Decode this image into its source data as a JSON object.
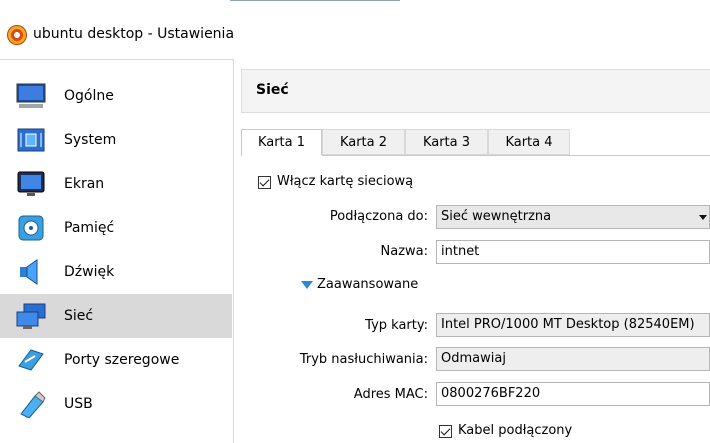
{
  "window": {
    "title": "ubuntu desktop - Ustawienia"
  },
  "sidebar": {
    "items": [
      {
        "label": "Ogólne",
        "icon": "monitor-general-icon"
      },
      {
        "label": "System",
        "icon": "chip-icon"
      },
      {
        "label": "Ekran",
        "icon": "display-icon"
      },
      {
        "label": "Pamięć",
        "icon": "disk-icon"
      },
      {
        "label": "Dźwięk",
        "icon": "speaker-icon"
      },
      {
        "label": "Sieć",
        "icon": "network-icon",
        "selected": true
      },
      {
        "label": "Porty szeregowe",
        "icon": "serial-port-icon"
      },
      {
        "label": "USB",
        "icon": "usb-icon"
      }
    ]
  },
  "panel": {
    "title": "Sieć",
    "tabs": [
      {
        "label": "Karta 1",
        "active": true
      },
      {
        "label": "Karta 2"
      },
      {
        "label": "Karta 3"
      },
      {
        "label": "Karta 4"
      }
    ],
    "enable_adapter_label": "Włącz kartę sieciową",
    "attached_to_label": "Podłączona do:",
    "attached_to_value": "Sieć wewnętrzna",
    "name_label": "Nazwa:",
    "name_value": "intnet",
    "advanced_label": "Zaawansowane",
    "adapter_type_label": "Typ karty:",
    "adapter_type_value": "Intel PRO/1000 MT Desktop (82540EM)",
    "promiscuous_label": "Tryb nasłuchiwania:",
    "promiscuous_value": "Odmawiaj",
    "mac_label": "Adres MAC:",
    "mac_value": "0800276BF220",
    "cable_label": "Kabel podłączony"
  },
  "colors": {
    "selected_bg": "#d9d9d9",
    "accent": "#2f86d6"
  }
}
